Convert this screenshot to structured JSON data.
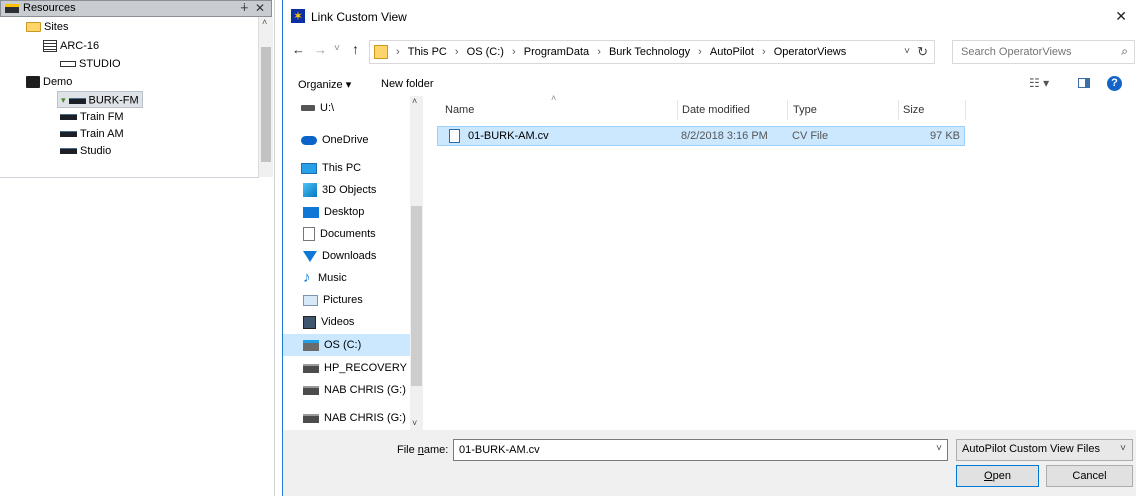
{
  "resources": {
    "title": "Resources",
    "pin_glyph": "∔",
    "close_glyph": "✕",
    "tree": [
      {
        "label": "Sites"
      },
      {
        "label": "ARC-16"
      },
      {
        "label": "STUDIO"
      },
      {
        "label": "Demo"
      },
      {
        "label": "BURK-FM"
      },
      {
        "label": "Train FM"
      },
      {
        "label": "Train AM"
      },
      {
        "label": "Studio"
      }
    ]
  },
  "dialog": {
    "title": "Link Custom View",
    "close_glyph": "✕",
    "nav": {
      "back": "←",
      "forward": "→",
      "recent": "˅",
      "up": "↑"
    },
    "address": {
      "crumbs": [
        "This PC",
        "OS (C:)",
        "ProgramData",
        "Burk Technology",
        "AutoPilot",
        "OperatorViews"
      ],
      "separator": "›",
      "dropdown": "˅",
      "refresh": "↻"
    },
    "search": {
      "placeholder": "Search OperatorViews",
      "icon": "⌕"
    },
    "toolbar": {
      "organize": "Organize ▾",
      "new_folder": "New folder",
      "view": "☷ ▾",
      "help": "?"
    },
    "nav_pane": [
      {
        "label": "U:\\"
      },
      {
        "label": "OneDrive"
      },
      {
        "label": "This PC"
      },
      {
        "label": "3D Objects"
      },
      {
        "label": "Desktop"
      },
      {
        "label": "Documents"
      },
      {
        "label": "Downloads"
      },
      {
        "label": "Music"
      },
      {
        "label": "Pictures"
      },
      {
        "label": "Videos"
      },
      {
        "label": "OS (C:)"
      },
      {
        "label": "HP_RECOVERY ("
      },
      {
        "label": "NAB CHRIS (G:)"
      },
      {
        "label": "NAB CHRIS (G:)"
      }
    ],
    "scroll": {
      "up": "˄",
      "down": "˅"
    },
    "file_list": {
      "columns": {
        "name": "Name",
        "date": "Date modified",
        "type": "Type",
        "size": "Size"
      },
      "sort_arrow": "˄",
      "files": [
        {
          "name": "01-BURK-AM.cv",
          "date": "8/2/2018 3:16 PM",
          "type": "CV File",
          "size": "97 KB"
        }
      ]
    },
    "bottom": {
      "file_name_prefix": "File ",
      "file_name_ul": "n",
      "file_name_suffix": "ame:",
      "file_name_value": "01-BURK-AM.cv",
      "file_type": "AutoPilot Custom View Files",
      "dropdown": "˅",
      "open_ul": "O",
      "open_rest": "pen",
      "cancel": "Cancel"
    }
  }
}
